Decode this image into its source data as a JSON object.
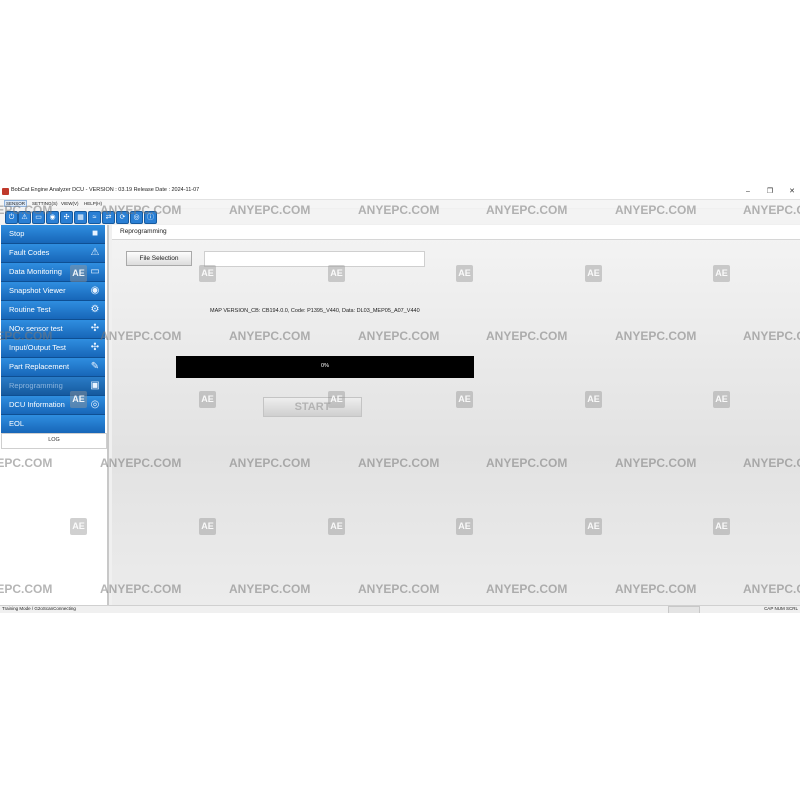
{
  "window": {
    "title": "BobCat Engine Analyzer DCU - VERSION : 03.19 Release Date : 2024-11-07",
    "minimize": "–",
    "restore": "❐",
    "close": "✕"
  },
  "menu": {
    "items": [
      {
        "label": "SENSOR"
      },
      {
        "label": "SETTING(S)"
      },
      {
        "label": "VIEW(V)"
      },
      {
        "label": "HELP(H)"
      }
    ]
  },
  "toolbar": {
    "buttons": [
      {
        "icon": "power-icon",
        "glyph": "⏻"
      },
      {
        "icon": "warning-icon",
        "glyph": "⚠"
      },
      {
        "icon": "monitor-icon",
        "glyph": "▭"
      },
      {
        "icon": "camera-icon",
        "glyph": "◉"
      },
      {
        "icon": "nodes-icon",
        "glyph": "✣"
      },
      {
        "icon": "grid-icon",
        "glyph": "▦"
      },
      {
        "icon": "pulse-icon",
        "glyph": "≈"
      },
      {
        "icon": "replace-icon",
        "glyph": "⇄"
      },
      {
        "icon": "reprogram-icon",
        "glyph": "⟳"
      },
      {
        "icon": "dcu-icon",
        "glyph": "◎"
      },
      {
        "icon": "info-icon",
        "glyph": "ⓘ"
      }
    ]
  },
  "sidebar": {
    "items": [
      {
        "label": "Stop",
        "icon": "stop-icon",
        "glyph": "■"
      },
      {
        "label": "Fault Codes",
        "icon": "warning-icon",
        "glyph": "⚠"
      },
      {
        "label": "Data Monitoring",
        "icon": "monitor-icon",
        "glyph": "▭"
      },
      {
        "label": "Snapshot Viewer",
        "icon": "camera-icon",
        "glyph": "◉"
      },
      {
        "label": "Routine Test",
        "icon": "routine-icon",
        "glyph": "⚙"
      },
      {
        "label": "NOx sensor test",
        "icon": "nodes-icon",
        "glyph": "✣"
      },
      {
        "label": "Input/Output Test",
        "icon": "io-icon",
        "glyph": "✣"
      },
      {
        "label": "Part Replacement",
        "icon": "replace-icon",
        "glyph": "✎"
      },
      {
        "label": "Reprogramming",
        "icon": "reprogram-icon",
        "glyph": "▣",
        "active": true
      },
      {
        "label": "DCU Information",
        "icon": "dcu-icon",
        "glyph": "◎"
      },
      {
        "label": "EOL",
        "icon": "eol-icon",
        "glyph": ""
      }
    ],
    "log_label": "LOG"
  },
  "main": {
    "panel_title": "Reprogramming",
    "file_selection_label": "File Selection",
    "file_path_value": "",
    "map_version": "MAP VERSION_CB: CB194.0.0, Code: P1395_V440, Data: DL03_MEP05_A07_V440",
    "progress_percent": 0,
    "progress_text": "0%",
    "start_label": "START"
  },
  "statusbar": {
    "left": "Training Mode / G2oScanConnecting",
    "right": "CAP NUM SCRL"
  },
  "watermark": {
    "text": "ANYEPC.COM",
    "logo": "AE"
  },
  "colors": {
    "sidebar_blue": "#1f7ad0",
    "progress_bg": "#000000",
    "accent": "#2a7fd4"
  }
}
